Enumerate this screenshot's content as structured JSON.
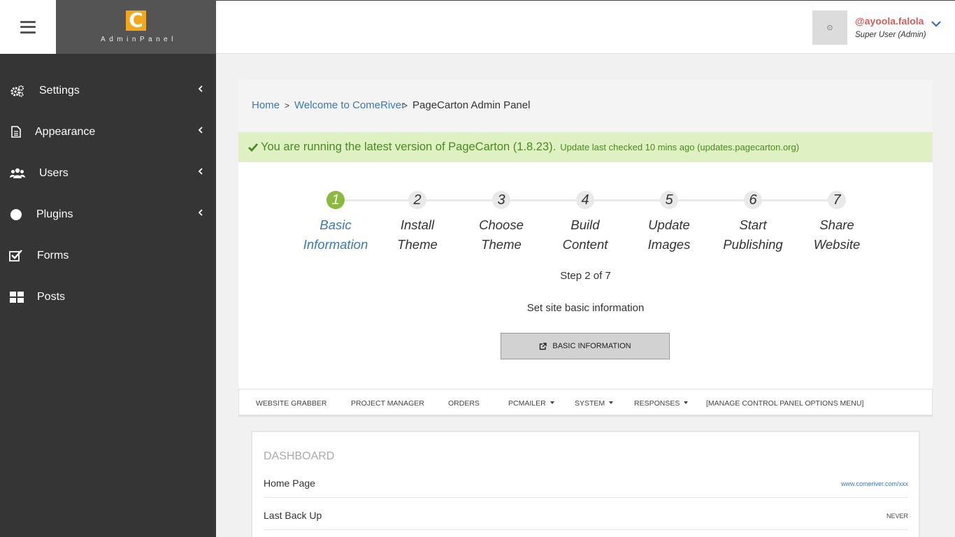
{
  "brand": {
    "name": "AdminPanel",
    "logo_letter": "C",
    "logo_color": "#f1a81d"
  },
  "sidebar": {
    "items": [
      {
        "label": "Settings",
        "icon": "gears-icon",
        "has_submenu": true
      },
      {
        "label": "Appearance",
        "icon": "document-icon",
        "has_submenu": true
      },
      {
        "label": "Users",
        "icon": "users-icon",
        "has_submenu": true
      },
      {
        "label": "Plugins",
        "icon": "circle-icon",
        "has_submenu": true
      },
      {
        "label": "Forms",
        "icon": "checkbox-icon",
        "has_submenu": false
      },
      {
        "label": "Posts",
        "icon": "grid-icon",
        "has_submenu": false
      }
    ]
  },
  "user": {
    "avatar_glyph": "⊙",
    "handle": "@ayoola.falola",
    "role": "Super User (Admin)"
  },
  "breadcrumb": {
    "home": "Home",
    "sep1": ">",
    "site": "Welcome to ComeRiver",
    "sep2": ">",
    "current": "PageCarton Admin Panel"
  },
  "alert": {
    "main": "You are running the latest version of PageCarton (1.8.23).",
    "sub": "Update last checked 10 mins ago (updates.pagecarton.org)"
  },
  "wizard": {
    "steps": [
      {
        "num": "1",
        "line1": "Basic",
        "line2": "Information",
        "active": true
      },
      {
        "num": "2",
        "line1": "Install",
        "line2": "Theme",
        "active": false
      },
      {
        "num": "3",
        "line1": "Choose",
        "line2": "Theme",
        "active": false
      },
      {
        "num": "4",
        "line1": "Build",
        "line2": "Content",
        "active": false
      },
      {
        "num": "5",
        "line1": "Update",
        "line2": "Images",
        "active": false
      },
      {
        "num": "6",
        "line1": "Start",
        "line2": "Publishing",
        "active": false
      },
      {
        "num": "7",
        "line1": "Share",
        "line2": "Website",
        "active": false
      }
    ],
    "progress": "Step 2 of 7",
    "description": "Set site basic information",
    "button_label": "BASIC INFORMATION"
  },
  "tabs": [
    {
      "label": "WEBSITE GRABBER",
      "dropdown": false
    },
    {
      "label": "PROJECT MANAGER",
      "dropdown": false
    },
    {
      "label": "ORDERS",
      "dropdown": false
    },
    {
      "label": "PCMAILER",
      "dropdown": true
    },
    {
      "label": "SYSTEM",
      "dropdown": true
    },
    {
      "label": "RESPONSES",
      "dropdown": true
    },
    {
      "label": "[MANAGE CONTROL PANEL OPTIONS MENU]",
      "dropdown": false
    }
  ],
  "dashboard": {
    "title": "DASHBOARD",
    "rows": [
      {
        "key": "Home Page",
        "value": "www.comeriver.com/xxx",
        "is_link": true
      },
      {
        "key": "Last Back Up",
        "value": "NEVER",
        "is_link": false
      }
    ]
  },
  "colors": {
    "sidebar_bg": "#353535",
    "accent_green": "#8ab93d",
    "link_blue": "#3b78b4",
    "alert_bg": "#dff0c2",
    "username_red": "#d45d5d"
  }
}
